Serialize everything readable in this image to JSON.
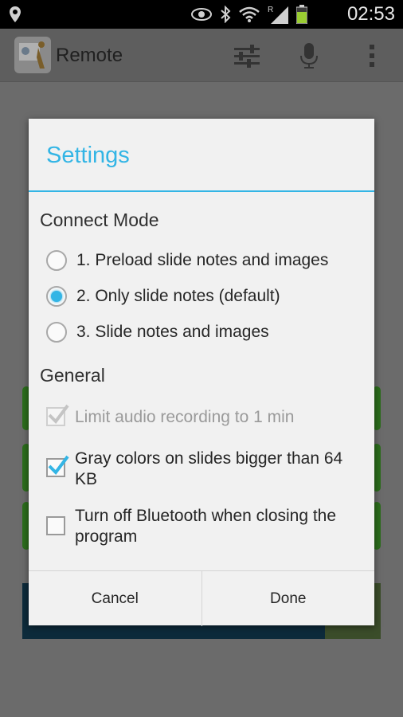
{
  "status_bar": {
    "time": "02:53",
    "icons": [
      "location-icon",
      "eye-icon",
      "bluetooth-icon",
      "wifi-icon",
      "signal-icon",
      "battery-icon"
    ]
  },
  "action_bar": {
    "title": "Remote",
    "icons": [
      "app-logo-icon",
      "sliders-icon",
      "microphone-icon",
      "overflow-menu-icon"
    ]
  },
  "dialog": {
    "title": "Settings",
    "connect_mode": {
      "heading": "Connect Mode",
      "options": [
        {
          "label": "1. Preload slide notes and images",
          "selected": false
        },
        {
          "label": "2. Only slide notes (default)",
          "selected": true
        },
        {
          "label": "3. Slide notes and images",
          "selected": false
        }
      ]
    },
    "general": {
      "heading": "General",
      "options": [
        {
          "label": "Limit audio recording to 1 min",
          "checked": true,
          "enabled": false
        },
        {
          "label": "Gray colors on slides bigger than 64 KB",
          "checked": true,
          "enabled": true
        },
        {
          "label": "Turn off Bluetooth when closing the program",
          "checked": false,
          "enabled": true
        }
      ]
    },
    "buttons": {
      "cancel": "Cancel",
      "done": "Done"
    }
  },
  "colors": {
    "accent": "#33b5e5",
    "dialog_bg": "#f1f1f1"
  }
}
